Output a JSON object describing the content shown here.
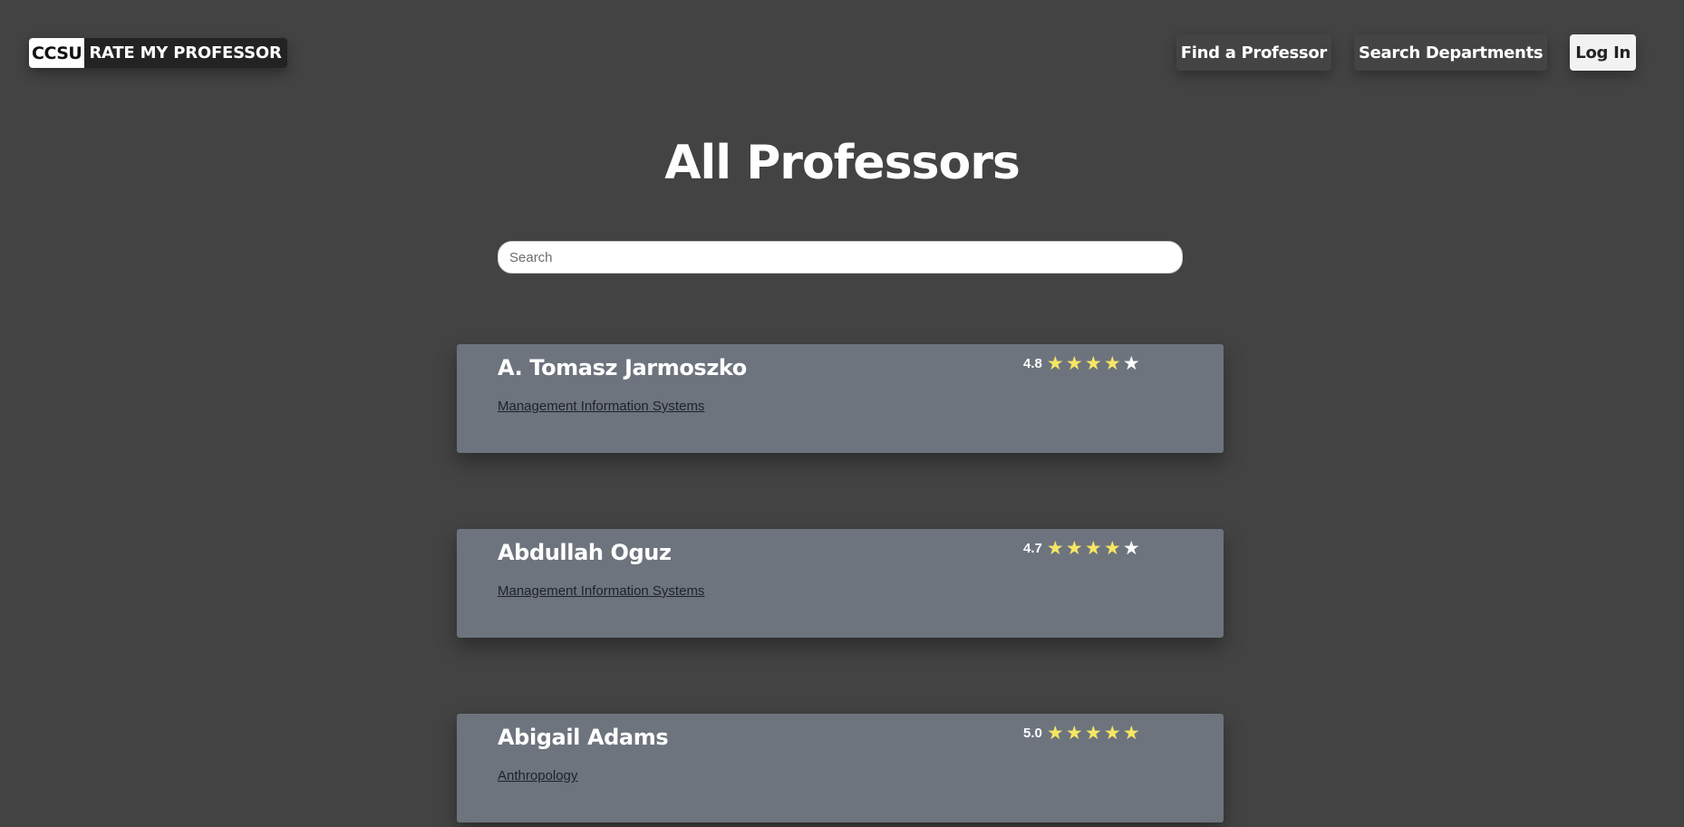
{
  "header": {
    "logo_ccsu": "CCSU",
    "logo_text": "RATE MY PROFESSOR",
    "nav": {
      "find_professor": "Find a Professor",
      "search_departments": "Search Departments",
      "login": "Log In"
    }
  },
  "main": {
    "title": "All Professors",
    "search": {
      "placeholder": "Search",
      "value": ""
    }
  },
  "colors": {
    "star_filled": "#f5e663",
    "star_empty": "#ffffff",
    "card_bg": "#6d747e",
    "page_bg": "#434343"
  },
  "professors": [
    {
      "name": "A. Tomasz Jarmoszko",
      "department": "Management Information Systems",
      "rating": "4.8",
      "stars_filled": 4,
      "stars_total": 5
    },
    {
      "name": "Abdullah Oguz",
      "department": "Management Information Systems",
      "rating": "4.7",
      "stars_filled": 4,
      "stars_total": 5
    },
    {
      "name": "Abigail Adams",
      "department": "Anthropology",
      "rating": "5.0",
      "stars_filled": 5,
      "stars_total": 5
    }
  ]
}
